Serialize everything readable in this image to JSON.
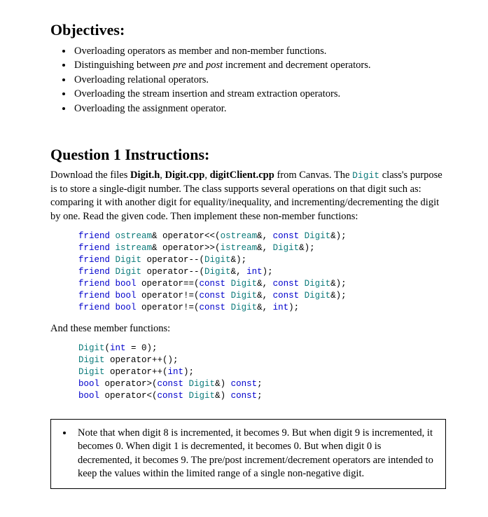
{
  "objectives": {
    "heading": "Objectives:",
    "items": [
      {
        "pre": "Overloading operators as member and non-member functions."
      },
      {
        "pre": "Distinguishing between ",
        "em1": "pre",
        "mid": " and ",
        "em2": "post",
        "post": " increment and decrement operators."
      },
      {
        "pre": "Overloading relational operators."
      },
      {
        "pre": "Overloading the stream insertion and stream extraction operators."
      },
      {
        "pre": "Overloading the assignment operator."
      }
    ]
  },
  "question1": {
    "heading": "Question 1 Instructions:",
    "intro": {
      "t1": "Download the files ",
      "f1": "Digit.h",
      "t2": ", ",
      "f2": "Digit.cpp",
      "t3": ", ",
      "f3": "digitClient.cpp",
      "t4": " from Canvas.  The ",
      "cls": "Digit",
      "t5": " class's purpose is to store a single-digit number.  The class supports several operations on that digit such as: comparing it with another digit for equality/inequality, and incrementing/decrementing the digit by one.  Read the given code.  Then implement these non-member functions:"
    },
    "nonmember_code": {
      "l1": {
        "a": "friend ",
        "b": "ostream",
        "c": "& operator<<(",
        "d": "ostream",
        "e": "&, ",
        "f": "const ",
        "g": "Digit",
        "h": "&);"
      },
      "l2": {
        "a": "friend ",
        "b": "istream",
        "c": "& operator>>(",
        "d": "istream",
        "e": "&, ",
        "f": "Digit",
        "g": "&);"
      },
      "l3": {
        "a": "friend ",
        "b": "Digit",
        "c": " operator--(",
        "d": "Digit",
        "e": "&);"
      },
      "l4": {
        "a": "friend ",
        "b": "Digit",
        "c": " operator--(",
        "d": "Digit",
        "e": "&, ",
        "f": "int",
        "g": ");"
      },
      "l5": {
        "a": "friend ",
        "b": "bool",
        "c": " operator==(",
        "d": "const ",
        "e": "Digit",
        "f": "&, ",
        "g": "const ",
        "h": "Digit",
        "i": "&);"
      },
      "l6": {
        "a": "friend ",
        "b": "bool",
        "c": " operator!=(",
        "d": "const ",
        "e": "Digit",
        "f": "&, ",
        "g": "const ",
        "h": "Digit",
        "i": "&);"
      },
      "l7": {
        "a": "friend ",
        "b": "bool",
        "c": " operator!=(",
        "d": "const ",
        "e": "Digit",
        "f": "&, ",
        "g": "int",
        "h": ");"
      }
    },
    "member_intro": "And these member functions:",
    "member_code": {
      "l1": {
        "a": "Digit",
        "b": "(",
        "c": "int",
        "d": " = 0);"
      },
      "l2": {
        "a": "Digit",
        "b": " operator++();"
      },
      "l3": {
        "a": "Digit",
        "b": " operator++(",
        "c": "int",
        "d": ");"
      },
      "l4": {
        "a": "bool",
        "b": " operator>(",
        "c": "const ",
        "d": "Digit",
        "e": "&) ",
        "f": "const",
        "g": ";"
      },
      "l5": {
        "a": "bool",
        "b": " operator<(",
        "c": "const ",
        "d": "Digit",
        "e": "&) ",
        "f": "const",
        "g": ";"
      }
    }
  },
  "note": {
    "text": "Note that when digit 8 is incremented, it becomes 9.  But when digit 9 is incremented, it becomes 0.  When digit 1 is decremented, it becomes 0.  But when digit 0 is decremented, it becomes 9.  The pre/post increment/decrement operators are intended to keep the values within the limited range of a single non-negative digit."
  }
}
